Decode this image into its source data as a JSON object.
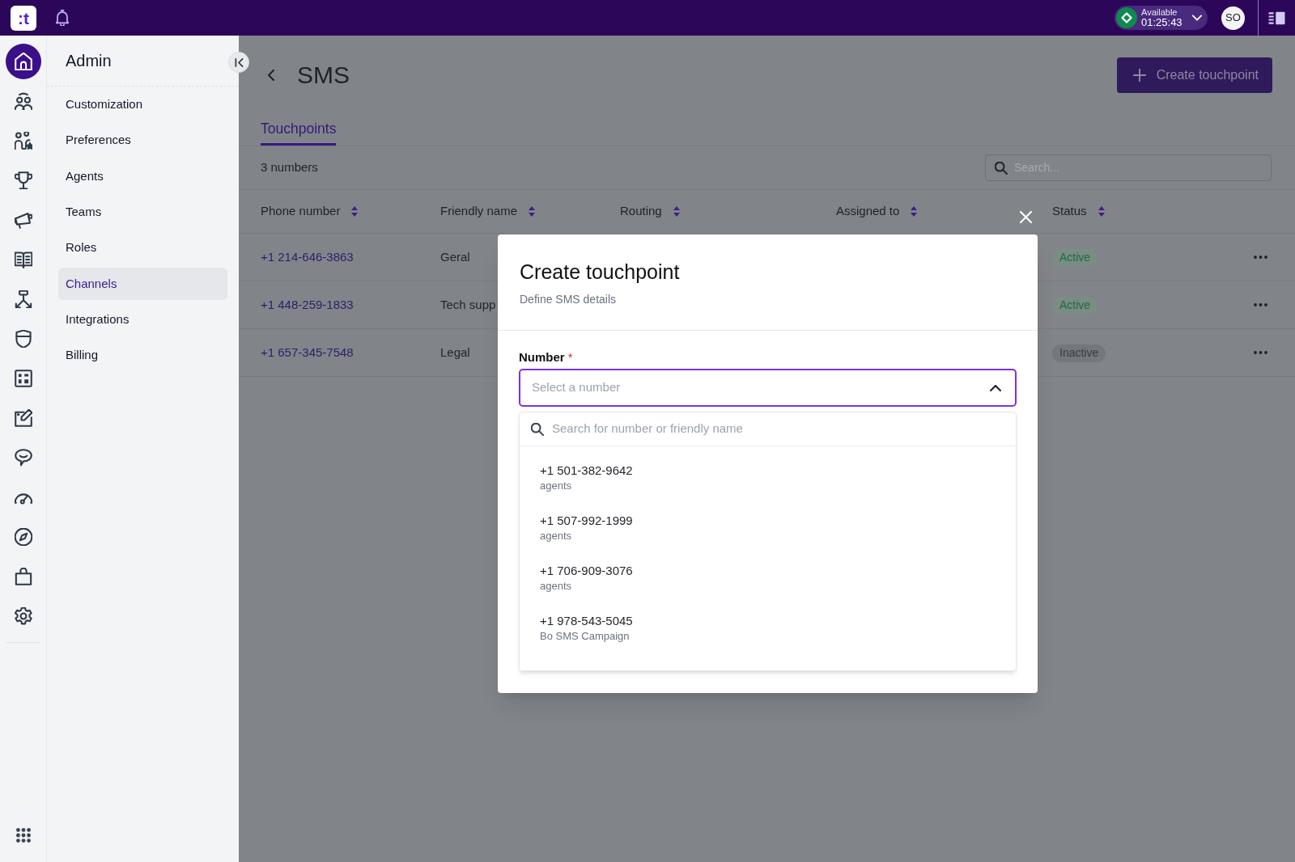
{
  "topbar": {
    "logo": ":t",
    "status": {
      "label": "Available",
      "timer": "01:25:43"
    },
    "avatar": "SO"
  },
  "rail": [
    {
      "selected": true
    },
    {
      "selected": false
    },
    {
      "selected": false
    },
    {
      "selected": false
    },
    {
      "selected": false
    },
    {
      "selected": false
    },
    {
      "selected": false
    },
    {
      "selected": false
    },
    {
      "selected": false
    },
    {
      "selected": false
    },
    {
      "selected": false
    },
    {
      "selected": false
    },
    {
      "selected": false
    },
    {
      "selected": false
    },
    {
      "selected": false
    }
  ],
  "sidebar": {
    "title": "Admin",
    "items": [
      {
        "label": "Customization",
        "selected": false
      },
      {
        "label": "Preferences",
        "selected": false
      },
      {
        "label": "Agents",
        "selected": false
      },
      {
        "label": "Teams",
        "selected": false
      },
      {
        "label": "Roles",
        "selected": false
      },
      {
        "label": "Channels",
        "selected": true
      },
      {
        "label": "Integrations",
        "selected": false
      },
      {
        "label": "Billing",
        "selected": false
      }
    ]
  },
  "page": {
    "title": "SMS",
    "create_button": "Create touchpoint",
    "tabs": [
      {
        "label": "Touchpoints",
        "selected": true
      }
    ],
    "count": "3 numbers",
    "search": {
      "placeholder": "Search..."
    }
  },
  "table": {
    "columns": [
      "Phone number",
      "Friendly name",
      "Routing",
      "Assigned to",
      "Status"
    ],
    "rows": [
      {
        "phone": "+1 214-646-3863",
        "friendly_name": "Geral",
        "status": "Active",
        "active": true
      },
      {
        "phone": "+1 448-259-1833",
        "friendly_name": "Tech supp",
        "status": "Active",
        "active": true
      },
      {
        "phone": "+1 657-345-7548",
        "friendly_name": "Legal",
        "status": "Inactive",
        "active": false
      }
    ]
  },
  "modal": {
    "title": "Create touchpoint",
    "subtitle": "Define SMS details",
    "field": {
      "label": "Number",
      "required_mark": "*",
      "placeholder": "Select a number",
      "expanded": true,
      "search_placeholder": "Search for number or friendly name",
      "options": [
        {
          "number": "+1 501-382-9642",
          "name": "agents"
        },
        {
          "number": "+1 507-992-1999",
          "name": "agents"
        },
        {
          "number": "+1 706-909-3076",
          "name": "agents"
        },
        {
          "number": "+1 978-543-5045",
          "name": "Bo SMS Campaign"
        }
      ]
    }
  }
}
